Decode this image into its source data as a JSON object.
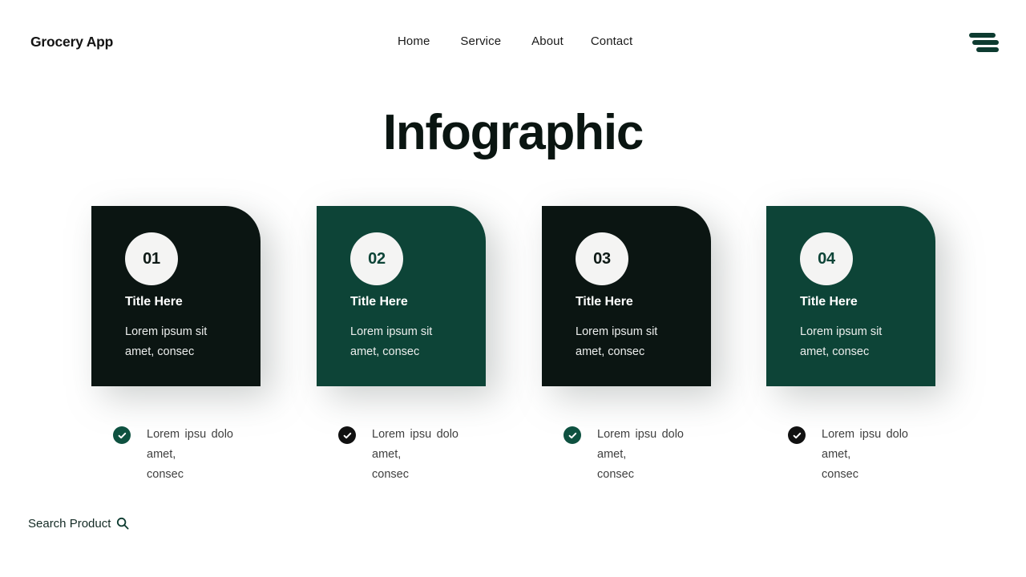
{
  "header": {
    "logo": "Grocery App",
    "nav": [
      {
        "label": "Home"
      },
      {
        "label": "Service"
      },
      {
        "label": "About"
      },
      {
        "label": "Contact"
      }
    ],
    "menu_icon": "hamburger-menu-icon",
    "menu_color": "#0d3b30"
  },
  "main": {
    "title": "Infographic",
    "cards": [
      {
        "number": "01",
        "title": "Title Here",
        "desc_main": "Lorem ipsum sit",
        "desc_last": "amet, consec",
        "theme": "dark",
        "bg": "#0b1512"
      },
      {
        "number": "02",
        "title": "Title Here",
        "desc_main": "Lorem ipsum sit",
        "desc_last": "amet, consec",
        "theme": "green",
        "bg": "#0d4437"
      },
      {
        "number": "03",
        "title": "Title Here",
        "desc_main": "Lorem ipsum sit",
        "desc_last": "amet, consec",
        "theme": "dark",
        "bg": "#0b1512"
      },
      {
        "number": "04",
        "title": "Title Here",
        "desc_main": "Lorem ipsum sit",
        "desc_last": "amet, consec",
        "theme": "green",
        "bg": "#0d4437"
      }
    ],
    "bullets": [
      {
        "icon": "check-circle-icon",
        "icon_color": "#0e5140",
        "text_main": "Lorem ipsu dolo amet,",
        "text_last": "consec"
      },
      {
        "icon": "check-circle-icon",
        "icon_color": "#111111",
        "text_main": "Lorem ipsu dolo amet,",
        "text_last": "consec"
      },
      {
        "icon": "check-circle-icon",
        "icon_color": "#0e5140",
        "text_main": "Lorem ipsu dolo amet,",
        "text_last": "consec"
      },
      {
        "icon": "check-circle-icon",
        "icon_color": "#111111",
        "text_main": "Lorem ipsu dolo amet,",
        "text_last": "consec"
      }
    ]
  },
  "footer": {
    "search_label": "Search Product",
    "search_icon": "magnifier-icon"
  }
}
